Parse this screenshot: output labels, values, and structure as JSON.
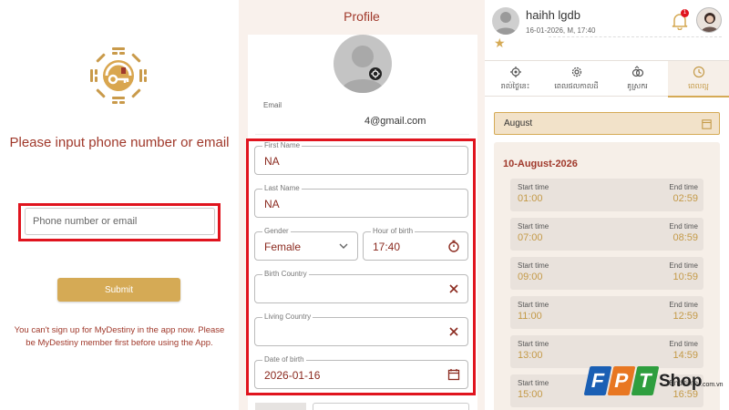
{
  "login": {
    "title": "Please input phone number or email",
    "phone_placeholder": "Phone number or email",
    "submit_label": "Submit",
    "note": "You can't sign up for MyDestiny in the app now. Please be MyDestiny member first before using the App."
  },
  "profile": {
    "title": "Profile",
    "email_label": "Email",
    "email_value": "4@gmail.com",
    "first_name_label": "First Name",
    "first_name_value": "NA",
    "last_name_label": "Last Name",
    "last_name_value": "NA",
    "gender_label": "Gender",
    "gender_value": "Female",
    "hour_label": "Hour of birth",
    "hour_value": "17:40",
    "birth_country_label": "Birth Country",
    "living_country_label": "Living Country",
    "dob_label": "Date of birth",
    "dob_value": "2026-01-16"
  },
  "schedule": {
    "user_name": "haihh lgdb",
    "user_sub": "16-01-2026, M, 17:40",
    "notification_count": "1",
    "tabs": [
      {
        "label": "រាល់ថ្ងៃនេះ",
        "icon": "gear-icon"
      },
      {
        "label": "ពេលផលកាលដី",
        "icon": "settings-icon"
      },
      {
        "label": "គូស្រករ",
        "icon": "rings-icon"
      },
      {
        "label": "ពេលល្អ",
        "icon": "clock-icon"
      }
    ],
    "month": "August",
    "day_title": "10-August-2026",
    "start_label": "Start time",
    "end_label": "End time",
    "slots": [
      {
        "start": "01:00",
        "end": "02:59"
      },
      {
        "start": "07:00",
        "end": "08:59"
      },
      {
        "start": "09:00",
        "end": "10:59"
      },
      {
        "start": "11:00",
        "end": "12:59"
      },
      {
        "start": "13:00",
        "end": "14:59"
      },
      {
        "start": "15:00",
        "end": "16:59"
      }
    ]
  },
  "watermark": {
    "letters": [
      "F",
      "P",
      "T"
    ],
    "shop": "Shop",
    "domain": ".com.vn"
  },
  "colors": {
    "accent_gold": "#d5aa55",
    "title_red": "#a0392b",
    "highlight_red": "#e0141e"
  }
}
